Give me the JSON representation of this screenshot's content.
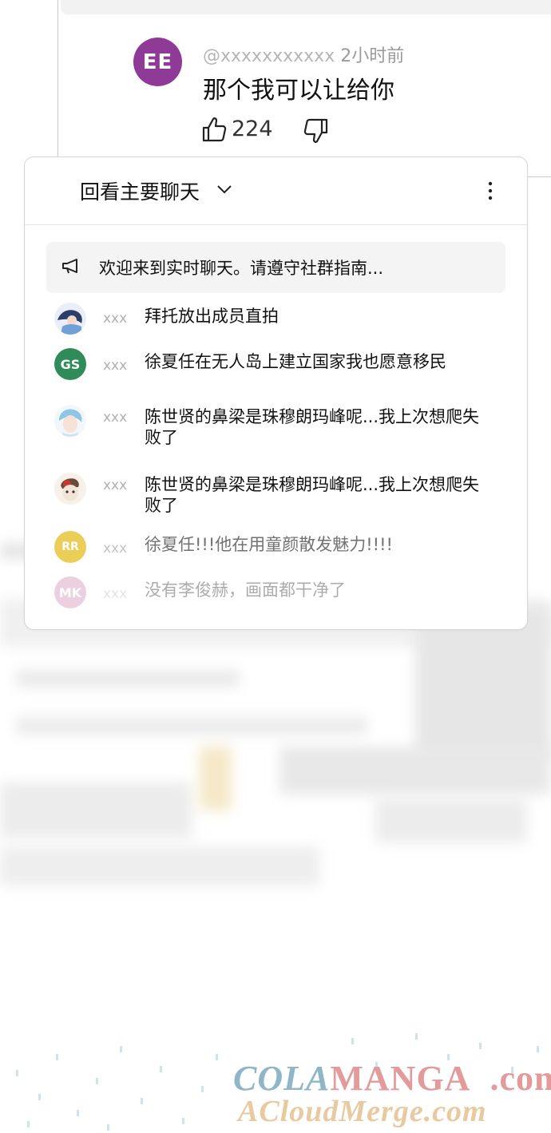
{
  "comment": {
    "avatar_initials": "EE",
    "avatar_color": "#8e3a96",
    "username": "@xxxxxxxxxxx",
    "time": "2小时前",
    "text": "那个我可以让给你",
    "likes": "224"
  },
  "chat": {
    "title": "回看主要聊天",
    "pinned_text": "欢迎来到实时聊天。请遵守社群指南...",
    "messages": [
      {
        "user": "xxx",
        "avatar_type": "image",
        "avatar_color": "#9fb6e0",
        "text": "拜托放出成员直拍"
      },
      {
        "user": "xxx",
        "avatar_type": "initials",
        "initials": "GS",
        "avatar_color": "#2f8c5a",
        "text": "徐夏任在无人岛上建立国家我也愿意移民"
      },
      {
        "user": "xxx",
        "avatar_type": "image",
        "avatar_color": "#bfe0ef",
        "text": "陈世贤的鼻梁是珠穆朗玛峰呢...我上次想爬失败了"
      },
      {
        "user": "xxx",
        "avatar_type": "image",
        "avatar_color": "#c98a6a",
        "text": "陈世贤的鼻梁是珠穆朗玛峰呢...我上次想爬失败了"
      },
      {
        "user": "xxx",
        "avatar_type": "initials",
        "initials": "RR",
        "avatar_color": "#e8c63a",
        "text": "徐夏任!!!他在用童颜散发魅力!!!!"
      },
      {
        "user": "xxx",
        "avatar_type": "initials",
        "initials": "MK",
        "avatar_color": "#c97aa8",
        "text": "没有李俊赫，画面都干净了"
      }
    ]
  },
  "watermark": {
    "brand_part1": "COLA",
    "brand_part2": "MANGA",
    "tld": ".com",
    "line2": "ACloudMerge.com"
  }
}
